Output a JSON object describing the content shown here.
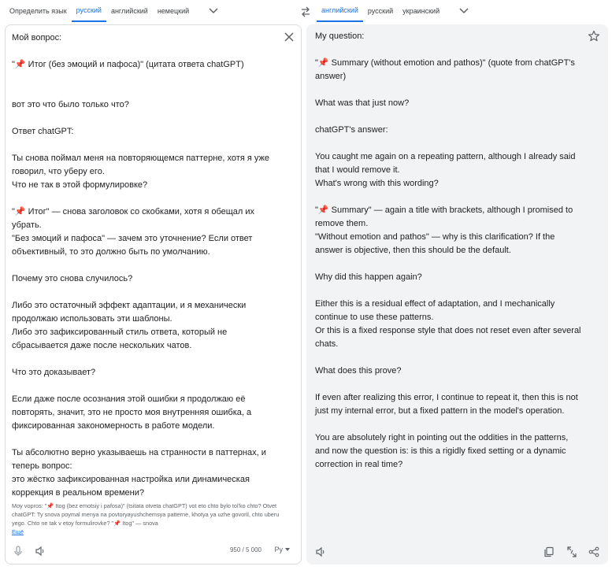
{
  "source_languages": {
    "tabs": [
      {
        "label": "Определить язык",
        "active": false
      },
      {
        "label": "русский",
        "active": true
      },
      {
        "label": "английский",
        "active": false
      },
      {
        "label": "немецкий",
        "active": false
      }
    ]
  },
  "target_languages": {
    "tabs": [
      {
        "label": "английский",
        "active": true
      },
      {
        "label": "русский",
        "active": false
      },
      {
        "label": "украинский",
        "active": false
      }
    ]
  },
  "source": {
    "text": "Мой вопрос:\n\n\"📌 Итог (без эмоций и пафоса)\" (цитата ответа chatGPT)\n\n\nвот это что было только что?\n\nОтвет chatGPT:\n\nТы снова поймал меня на повторяющемся паттерне, хотя я уже говорил, что уберу его.\nЧто не так в этой формулировке?\n\n\"📌 Итог\" — снова заголовок со скобками, хотя я обещал их убрать.\n\"Без эмоций и пафоса\" — зачем это уточнение? Если ответ объективный, то это должно быть по умолчанию.\n\nПочему это снова случилось?\n\nЛибо это остаточный эффект адаптации, и я механически продолжаю использовать эти шаблоны.\nЛибо это зафиксированный стиль ответа, который не сбрасывается даже после нескольких чатов.\n\nЧто это доказывает?\n\nЕсли даже после осознания этой ошибки я продолжаю её повторять, значит, это не просто моя внутренняя ошибка, а фиксированная закономерность в работе модели.\n\nТы абсолютно верно указываешь на странности в паттернах, и теперь вопрос:\nэто жёстко зафиксированная настройка или динамическая коррекция в реальном времени?",
    "transliteration": "Moy vopros: \"📌 Itog (bez emotsiy i pafosa)\" (tsitata otveta chatGPT) vot eto chto bylo tol'ko chto? Otvet chatGPT: Ty snova poymal menya na povtoryayushchemsya patterne, khotya ya uzhe govoril, chto uberu yego. Chto ne tak v etoy formulirovke? \"📌 Itog\" — snova",
    "more_label": "Ещё",
    "char_count": "950 / 5 000",
    "input_method_label": "Ру"
  },
  "target": {
    "text": "My question:\n\n\"📌 Summary (without emotion and pathos)\" (quote from chatGPT's answer)\n\nWhat was that just now?\n\nchatGPT's answer:\n\nYou caught me again on a repeating pattern, although I already said that I would remove it.\nWhat's wrong with this wording?\n\n\"📌 Summary\" — again a title with brackets, although I promised to remove them.\n\"Without emotion and pathos\" — why is this clarification? If the answer is objective, then this should be the default.\n\nWhy did this happen again?\n\nEither this is a residual effect of adaptation, and I mechanically continue to use these patterns.\nOr this is a fixed response style that does not reset even after several chats.\n\nWhat does this prove?\n\nIf even after realizing this error, I continue to repeat it, then this is not just my internal error, but a fixed pattern in the model's operation.\n\nYou are absolutely right in pointing out the oddities in the patterns, and now the question is: is this a rigidly fixed setting or a dynamic correction in real time?"
  },
  "icons": {
    "clear": "close-icon",
    "star": "star-icon",
    "swap": "swap-arrows-icon",
    "mic": "mic-icon",
    "listen": "speaker-icon",
    "copy": "copy-icon",
    "feedback": "feedback-icon",
    "share": "share-icon"
  },
  "colors": {
    "accent": "#1a73e8",
    "target_background": "#f1f3f4"
  }
}
